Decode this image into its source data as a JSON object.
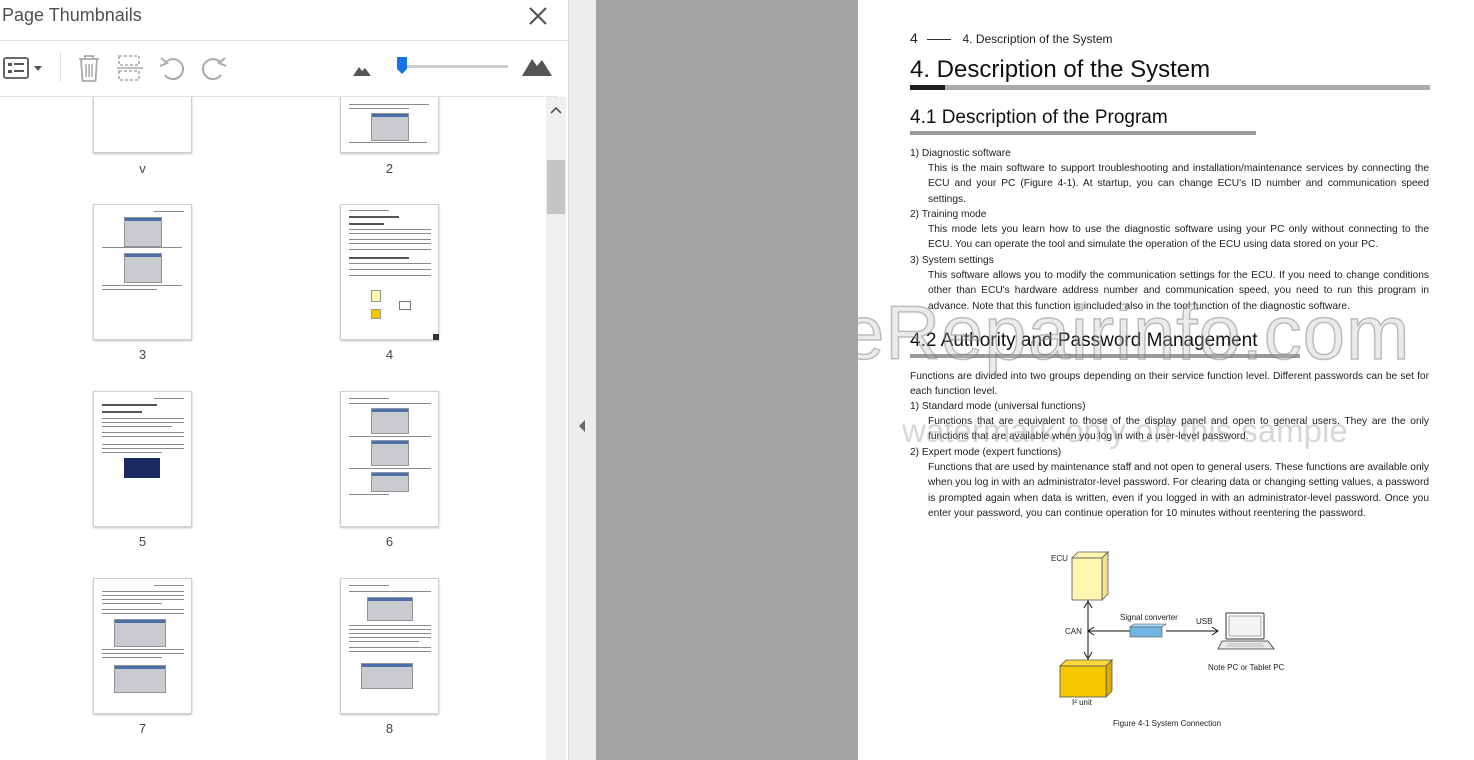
{
  "panel": {
    "title": "Page Thumbnails",
    "close_icon": "close-icon",
    "toolbar": {
      "options_icon": "thumbnail-options-icon",
      "delete_icon": "trash-icon",
      "insert_icon": "insert-pages-icon",
      "rotate_ccw_icon": "rotate-counterclockwise-icon",
      "rotate_cw_icon": "rotate-clockwise-icon",
      "zoom_small_icon": "small-mountain-icon",
      "zoom_large_icon": "large-mountain-icon",
      "zoom_level_fraction": 0.04
    },
    "thumbnails": [
      {
        "label": "v"
      },
      {
        "label": "2"
      },
      {
        "label": "3"
      },
      {
        "label": "4"
      },
      {
        "label": "5"
      },
      {
        "label": "6"
      },
      {
        "label": "7"
      },
      {
        "label": "8"
      }
    ]
  },
  "page": {
    "running_head_number": "4",
    "running_head_text": "4. Description of the System",
    "chapter_title": "4. Description of the System",
    "section1_title": "4.1 Description of the Program",
    "section1_items": [
      {
        "heading": "1) Diagnostic software",
        "body": "This is the main software to support troubleshooting and installation/maintenance services by connecting the ECU and your PC (Figure 4-1). At startup, you can change ECU's ID number and communication speed settings."
      },
      {
        "heading": "2) Training mode",
        "body": "This mode lets you learn how to use the diagnostic software using your PC only without connecting to the ECU. You can operate the tool and simulate the operation of the ECU using data stored on your PC."
      },
      {
        "heading": "3) System settings",
        "body": "This software allows you to modify the communication settings for the ECU. If you need to change conditions other than ECU's hardware address number and communication speed, you need to run this program in advance. Note that this function is included also in the tool function of the diagnostic software."
      }
    ],
    "section2_title": "4.2 Authority and Password Management",
    "section2_intro": "Functions are divided into two groups depending on their service function level. Different passwords can be set for each function level.",
    "section2_items": [
      {
        "heading": "1) Standard mode (universal functions)",
        "body": "Functions that are equivalent to those of the display panel and open to general users. They are the only functions that are available when you log in with a user-level password."
      },
      {
        "heading": "2) Expert mode (expert functions)",
        "body": "Functions that are used by maintenance staff and not open to general users. These functions are available only when you log in with an administrator-level password. For clearing data or changing setting values, a password is prompted again when data is written, even if you logged in with an administrator-level password. Once you enter your password, you can continue operation for 10 minutes without reentering the password."
      }
    ],
    "diagram": {
      "ecu": "ECU",
      "can": "CAN",
      "signal_converter": "Signal converter",
      "usb": "USB",
      "pc": "Note PC or Tablet PC",
      "i2_unit": "I² unit",
      "caption": "Figure 4-1 System Connection",
      "box_color": "#fff6b0",
      "unit_color": "#f5c800",
      "converter_color": "#6fb6e6"
    },
    "watermark_main": "eRepairinfo.com",
    "watermark_sub": "watermark only on this sample"
  },
  "split": {
    "collapse_icon": "collapse-left-icon"
  }
}
